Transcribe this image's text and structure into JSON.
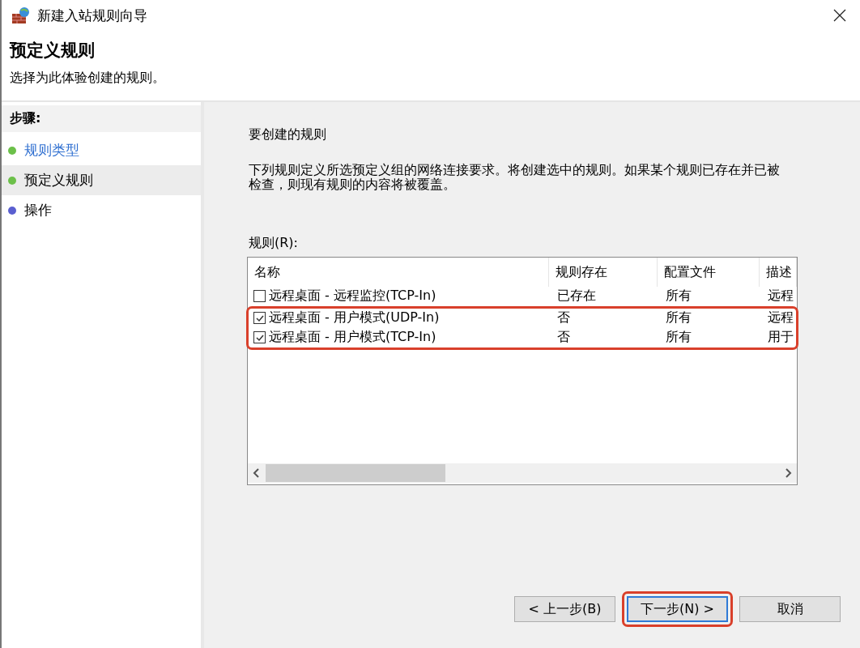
{
  "window": {
    "title": "新建入站规则向导"
  },
  "header": {
    "title": "预定义规则",
    "subtitle": "选择为此体验创建的规则。"
  },
  "steps": {
    "heading": "步骤:",
    "items": [
      {
        "label": "规则类型",
        "selected": false,
        "color": "#6cc04a",
        "link": true
      },
      {
        "label": "预定义规则",
        "selected": true,
        "color": "#6cc04a",
        "link": false
      },
      {
        "label": "操作",
        "selected": false,
        "color": "#5a5fd0",
        "link": false
      }
    ]
  },
  "content": {
    "heading": "要创建的规则",
    "description": "下列规则定义所选预定义组的网络连接要求。将创建选中的规则。如果某个规则已存在并已被检查，则现有规则的内容将被覆盖。",
    "list_label": "规则(R):"
  },
  "table": {
    "columns": [
      "名称",
      "规则存在",
      "配置文件",
      "描述"
    ],
    "rows": [
      {
        "checked": false,
        "highlighted": false,
        "cells": [
          "远程桌面 - 远程监控(TCP-In)",
          "已存在",
          "所有",
          "远程"
        ]
      },
      {
        "checked": true,
        "highlighted": true,
        "cells": [
          "远程桌面 - 用户模式(UDP-In)",
          "否",
          "所有",
          "远程"
        ]
      },
      {
        "checked": true,
        "highlighted": true,
        "cells": [
          "远程桌面 - 用户模式(TCP-In)",
          "否",
          "所有",
          "用于"
        ]
      }
    ]
  },
  "buttons": [
    {
      "label": "< 上一步(B)",
      "highlighted": false,
      "default": false
    },
    {
      "label": "下一步(N) >",
      "highlighted": true,
      "default": true
    },
    {
      "label": "取消",
      "highlighted": false,
      "default": false
    }
  ]
}
